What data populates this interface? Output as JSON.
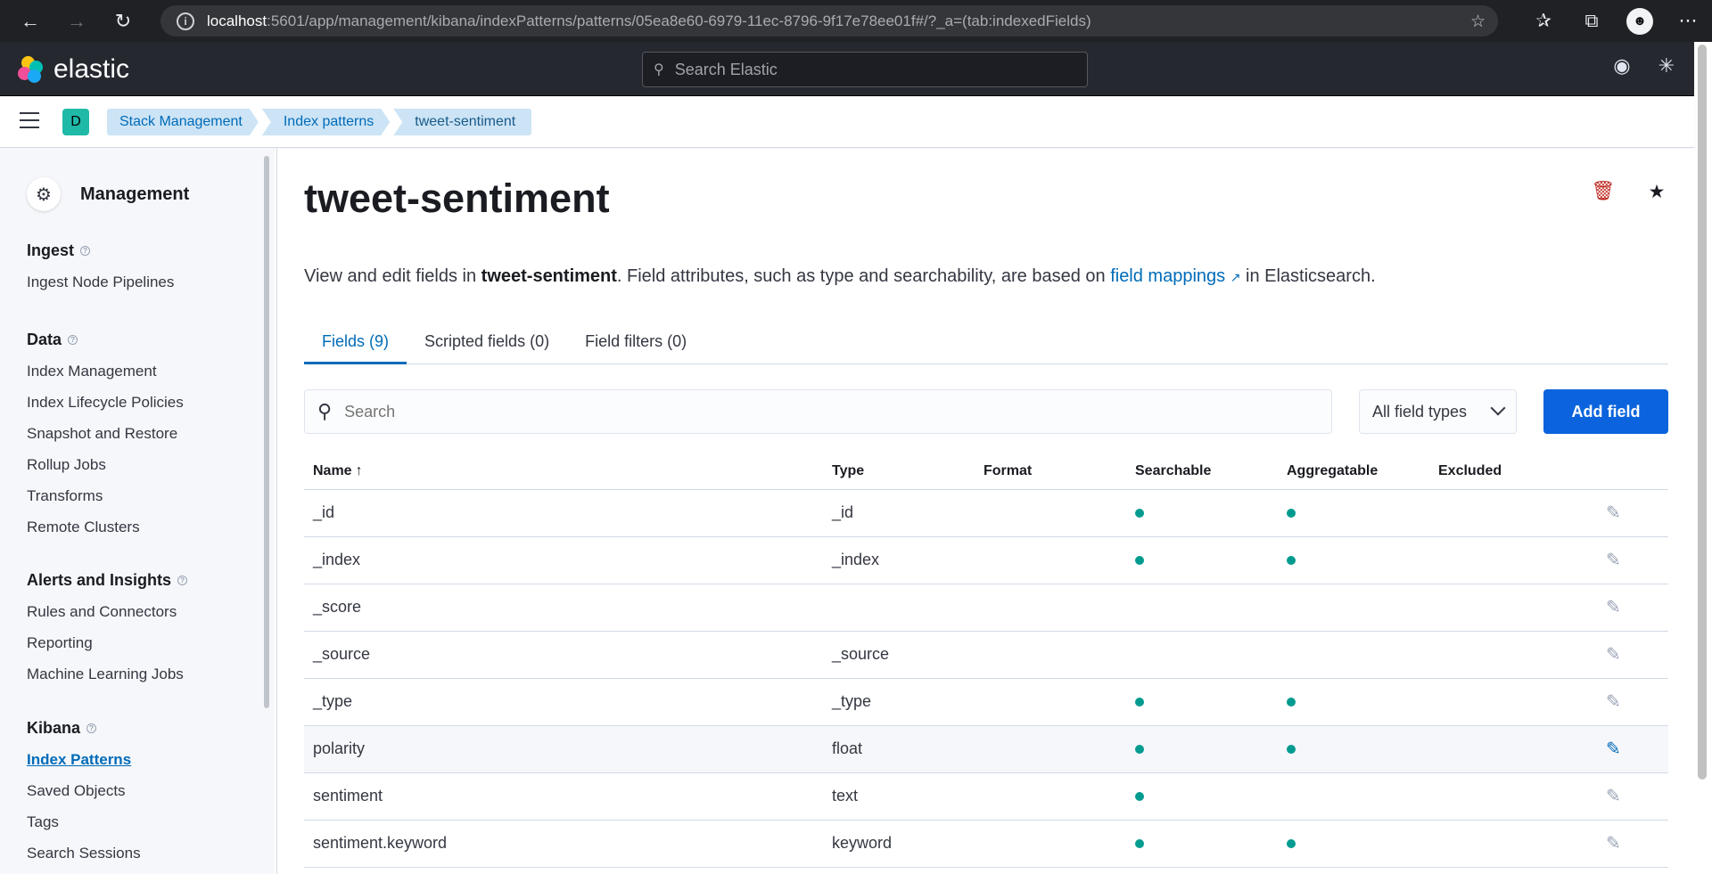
{
  "browser": {
    "url_host": "localhost",
    "url_path": ":5601/app/management/kibana/indexPatterns/patterns/05ea8e60-6979-11ec-8796-9f17e78ee01f#/?_a=(tab:indexedFields)"
  },
  "header": {
    "logo_text": "elastic",
    "search_placeholder": "Search Elastic"
  },
  "breadcrumbs": {
    "space_initial": "D",
    "items": [
      "Stack Management",
      "Index patterns",
      "tweet-sentiment"
    ]
  },
  "sidebar": {
    "title": "Management",
    "groups": [
      {
        "title": "Ingest",
        "items": [
          "Ingest Node Pipelines"
        ]
      },
      {
        "title": "Data",
        "items": [
          "Index Management",
          "Index Lifecycle Policies",
          "Snapshot and Restore",
          "Rollup Jobs",
          "Transforms",
          "Remote Clusters"
        ]
      },
      {
        "title": "Alerts and Insights",
        "items": [
          "Rules and Connectors",
          "Reporting",
          "Machine Learning Jobs"
        ]
      },
      {
        "title": "Kibana",
        "items": [
          "Index Patterns",
          "Saved Objects",
          "Tags",
          "Search Sessions"
        ]
      }
    ]
  },
  "main": {
    "title": "tweet-sentiment",
    "desc_prefix": "View and edit fields in ",
    "desc_bold": "tweet-sentiment",
    "desc_middle": ". Field attributes, such as type and searchability, are based on ",
    "desc_link": "field mappings",
    "desc_suffix": " in Elasticsearch.",
    "tabs": [
      "Fields (9)",
      "Scripted fields (0)",
      "Field filters (0)"
    ],
    "search_placeholder": "Search",
    "type_filter": "All field types",
    "add_field": "Add field"
  },
  "table": {
    "headers": [
      "Name",
      "Type",
      "Format",
      "Searchable",
      "Aggregatable",
      "Excluded"
    ],
    "rows": [
      {
        "name": "_id",
        "type": "_id",
        "searchable": true,
        "aggregatable": true
      },
      {
        "name": "_index",
        "type": "_index",
        "searchable": true,
        "aggregatable": true
      },
      {
        "name": "_score",
        "type": "",
        "searchable": false,
        "aggregatable": false
      },
      {
        "name": "_source",
        "type": "_source",
        "searchable": false,
        "aggregatable": false
      },
      {
        "name": "_type",
        "type": "_type",
        "searchable": true,
        "aggregatable": true
      },
      {
        "name": "polarity",
        "type": "float",
        "searchable": true,
        "aggregatable": true
      },
      {
        "name": "sentiment",
        "type": "text",
        "searchable": true,
        "aggregatable": false
      },
      {
        "name": "sentiment.keyword",
        "type": "keyword",
        "searchable": true,
        "aggregatable": true
      }
    ]
  },
  "colors": {
    "accent": "#006bb8",
    "button": "#0b64dd",
    "dot": "#019b8f",
    "header_bg": "#25282f"
  }
}
